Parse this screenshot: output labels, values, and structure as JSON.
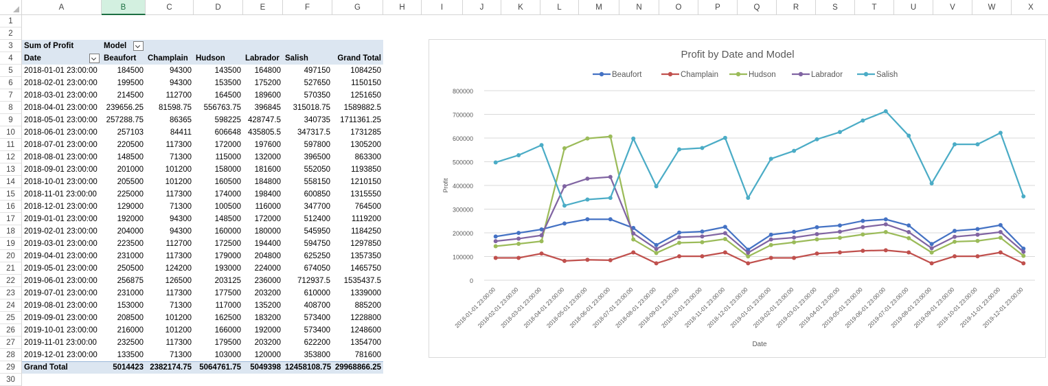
{
  "columns": [
    "A",
    "B",
    "C",
    "D",
    "E",
    "F",
    "G",
    "H",
    "I",
    "J",
    "K",
    "L",
    "M",
    "N",
    "O",
    "P",
    "Q",
    "R",
    "S",
    "T",
    "U",
    "V",
    "W",
    "X"
  ],
  "selected_column": "B",
  "row_numbers": [
    "1",
    "2",
    "3",
    "4",
    "5",
    "6",
    "7",
    "8",
    "9",
    "10",
    "11",
    "12",
    "13",
    "14",
    "15",
    "16",
    "17",
    "18",
    "19",
    "20",
    "21",
    "22",
    "23",
    "24",
    "25",
    "26",
    "27",
    "28",
    "29",
    "30"
  ],
  "pivot": {
    "value_label": "Sum of Profit",
    "col_field": "Model",
    "row_field": "Date",
    "headers": [
      "Beaufort",
      "Champlain",
      "Hudson",
      "Labrador",
      "Salish",
      "Grand Total"
    ],
    "rows": [
      {
        "date": "2018-01-01 23:00:00",
        "v": [
          "184500",
          "94300",
          "143500",
          "164800",
          "497150",
          "1084250"
        ]
      },
      {
        "date": "2018-02-01 23:00:00",
        "v": [
          "199500",
          "94300",
          "153500",
          "175200",
          "527650",
          "1150150"
        ]
      },
      {
        "date": "2018-03-01 23:00:00",
        "v": [
          "214500",
          "112700",
          "164500",
          "189600",
          "570350",
          "1251650"
        ]
      },
      {
        "date": "2018-04-01 23:00:00",
        "v": [
          "239656.25",
          "81598.75",
          "556763.75",
          "396845",
          "315018.75",
          "1589882.5"
        ]
      },
      {
        "date": "2018-05-01 23:00:00",
        "v": [
          "257288.75",
          "86365",
          "598225",
          "428747.5",
          "340735",
          "1711361.25"
        ]
      },
      {
        "date": "2018-06-01 23:00:00",
        "v": [
          "257103",
          "84411",
          "606648",
          "435805.5",
          "347317.5",
          "1731285"
        ]
      },
      {
        "date": "2018-07-01 23:00:00",
        "v": [
          "220500",
          "117300",
          "172000",
          "197600",
          "597800",
          "1305200"
        ]
      },
      {
        "date": "2018-08-01 23:00:00",
        "v": [
          "148500",
          "71300",
          "115000",
          "132000",
          "396500",
          "863300"
        ]
      },
      {
        "date": "2018-09-01 23:00:00",
        "v": [
          "201000",
          "101200",
          "158000",
          "181600",
          "552050",
          "1193850"
        ]
      },
      {
        "date": "2018-10-01 23:00:00",
        "v": [
          "205500",
          "101200",
          "160500",
          "184800",
          "558150",
          "1210150"
        ]
      },
      {
        "date": "2018-11-01 23:00:00",
        "v": [
          "225000",
          "117300",
          "174000",
          "198400",
          "600850",
          "1315550"
        ]
      },
      {
        "date": "2018-12-01 23:00:00",
        "v": [
          "129000",
          "71300",
          "100500",
          "116000",
          "347700",
          "764500"
        ]
      },
      {
        "date": "2019-01-01 23:00:00",
        "v": [
          "192000",
          "94300",
          "148500",
          "172000",
          "512400",
          "1119200"
        ]
      },
      {
        "date": "2019-02-01 23:00:00",
        "v": [
          "204000",
          "94300",
          "160000",
          "180000",
          "545950",
          "1184250"
        ]
      },
      {
        "date": "2019-03-01 23:00:00",
        "v": [
          "223500",
          "112700",
          "172500",
          "194400",
          "594750",
          "1297850"
        ]
      },
      {
        "date": "2019-04-01 23:00:00",
        "v": [
          "231000",
          "117300",
          "179000",
          "204800",
          "625250",
          "1357350"
        ]
      },
      {
        "date": "2019-05-01 23:00:00",
        "v": [
          "250500",
          "124200",
          "193000",
          "224000",
          "674050",
          "1465750"
        ]
      },
      {
        "date": "2019-06-01 23:00:00",
        "v": [
          "256875",
          "126500",
          "203125",
          "236000",
          "712937.5",
          "1535437.5"
        ]
      },
      {
        "date": "2019-07-01 23:00:00",
        "v": [
          "231000",
          "117300",
          "177500",
          "203200",
          "610000",
          "1339000"
        ]
      },
      {
        "date": "2019-08-01 23:00:00",
        "v": [
          "153000",
          "71300",
          "117000",
          "135200",
          "408700",
          "885200"
        ]
      },
      {
        "date": "2019-09-01 23:00:00",
        "v": [
          "208500",
          "101200",
          "162500",
          "183200",
          "573400",
          "1228800"
        ]
      },
      {
        "date": "2019-10-01 23:00:00",
        "v": [
          "216000",
          "101200",
          "166000",
          "192000",
          "573400",
          "1248600"
        ]
      },
      {
        "date": "2019-11-01 23:00:00",
        "v": [
          "232500",
          "117300",
          "179500",
          "203200",
          "622200",
          "1354700"
        ]
      },
      {
        "date": "2019-12-01 23:00:00",
        "v": [
          "133500",
          "71300",
          "103000",
          "120000",
          "353800",
          "781600"
        ]
      }
    ],
    "grand_label": "Grand Total",
    "grand": [
      "5014423",
      "2382174.75",
      "5064761.75",
      "5049398",
      "12458108.75",
      "29968866.25"
    ]
  },
  "chart_data": {
    "type": "line",
    "title": "Profit by Date and Model",
    "xlabel": "Date",
    "ylabel": "Profit",
    "ylim": [
      0,
      800000
    ],
    "yticks": [
      "0",
      "100000",
      "200000",
      "300000",
      "400000",
      "500000",
      "600000",
      "700000",
      "800000"
    ],
    "legend_position": "top",
    "categories": [
      "2018-01-01 23:00:00",
      "2018-02-01 23:00:00",
      "2018-03-01 23:00:00",
      "2018-04-01 23:00:00",
      "2018-05-01 23:00:00",
      "2018-06-01 23:00:00",
      "2018-07-01 23:00:00",
      "2018-08-01 23:00:00",
      "2018-09-01 23:00:00",
      "2018-10-01 23:00:00",
      "2018-11-01 23:00:00",
      "2018-12-01 23:00:00",
      "2019-01-01 23:00:00",
      "2019-02-01 23:00:00",
      "2019-03-01 23:00:00",
      "2019-04-01 23:00:00",
      "2019-05-01 23:00:00",
      "2019-06-01 23:00:00",
      "2019-07-01 23:00:00",
      "2019-08-01 23:00:00",
      "2019-09-01 23:00:00",
      "2019-10-01 23:00:00",
      "2019-11-01 23:00:00",
      "2019-12-01 23:00:00"
    ],
    "series": [
      {
        "name": "Beaufort",
        "color": "#4472c4",
        "values": [
          184500,
          199500,
          214500,
          239656.25,
          257288.75,
          257103,
          220500,
          148500,
          201000,
          205500,
          225000,
          129000,
          192000,
          204000,
          223500,
          231000,
          250500,
          256875,
          231000,
          153000,
          208500,
          216000,
          232500,
          133500
        ]
      },
      {
        "name": "Champlain",
        "color": "#c0504d",
        "values": [
          94300,
          94300,
          112700,
          81598.75,
          86365,
          84411,
          117300,
          71300,
          101200,
          101200,
          117300,
          71300,
          94300,
          94300,
          112700,
          117300,
          124200,
          126500,
          117300,
          71300,
          101200,
          101200,
          117300,
          71300
        ]
      },
      {
        "name": "Hudson",
        "color": "#9bbb59",
        "values": [
          143500,
          153500,
          164500,
          556763.75,
          598225,
          606648,
          172000,
          115000,
          158000,
          160500,
          174000,
          100500,
          148500,
          160000,
          172500,
          179000,
          193000,
          203125,
          177500,
          117000,
          162500,
          166000,
          179500,
          103000
        ]
      },
      {
        "name": "Labrador",
        "color": "#8064a2",
        "values": [
          164800,
          175200,
          189600,
          396845,
          428747.5,
          435805.5,
          197600,
          132000,
          181600,
          184800,
          198400,
          116000,
          172000,
          180000,
          194400,
          204800,
          224000,
          236000,
          203200,
          135200,
          183200,
          192000,
          203200,
          120000
        ]
      },
      {
        "name": "Salish",
        "color": "#4bacc6",
        "values": [
          497150,
          527650,
          570350,
          315018.75,
          340735,
          347317.5,
          597800,
          396500,
          552050,
          558150,
          600850,
          347700,
          512400,
          545950,
          594750,
          625250,
          674050,
          712937.5,
          610000,
          408700,
          573400,
          573400,
          622200,
          353800
        ]
      }
    ]
  }
}
